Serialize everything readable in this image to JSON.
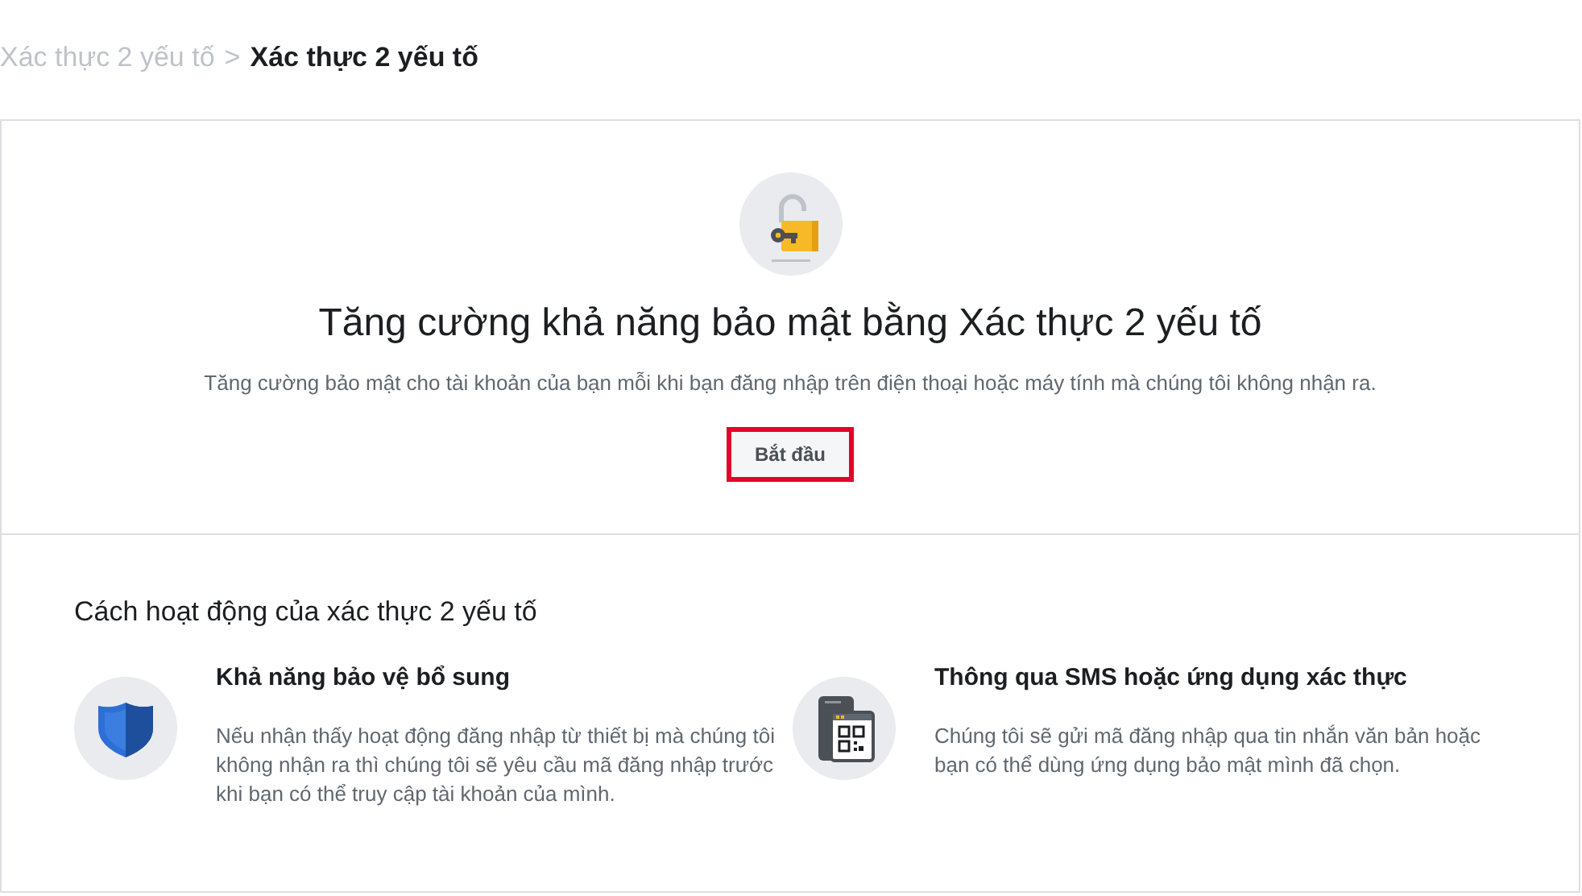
{
  "breadcrumb": {
    "parent": "Xác thực 2 yếu tố",
    "separator": ">",
    "current": "Xác thực 2 yếu tố"
  },
  "hero": {
    "title": "Tăng cường khả năng bảo mật bằng Xác thực 2 yếu tố",
    "subtitle": "Tăng cường bảo mật cho tài khoản của bạn mỗi khi bạn đăng nhập trên điện thoại hoặc máy tính mà chúng tôi không nhận ra.",
    "button": {
      "label": "Bắt đầu",
      "highlighted": true
    }
  },
  "how_it_works": {
    "heading": "Cách hoạt động của xác thực 2 yếu tố",
    "features": [
      {
        "kind": "shield",
        "title": "Khả năng bảo vệ bổ sung",
        "description": "Nếu nhận thấy hoạt động đăng nhập từ thiết bị mà chúng tôi không nhận ra thì chúng tôi sẽ yêu cầu mã đăng nhập trước khi bạn có thể truy cập tài khoản của mình."
      },
      {
        "kind": "phone",
        "title": "Thông qua SMS hoặc ứng dụng xác thực",
        "description": "Chúng tôi sẽ gửi mã đăng nhập qua tin nhắn văn bản hoặc bạn có thể dùng ứng dụng bảo mật mình đã chọn."
      }
    ]
  }
}
